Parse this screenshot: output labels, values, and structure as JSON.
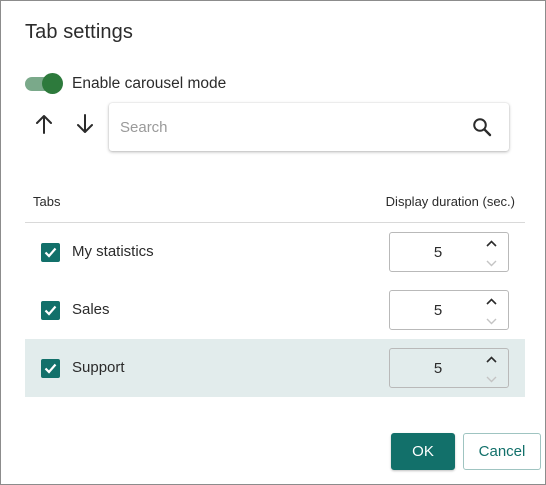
{
  "dialog": {
    "title": "Tab settings"
  },
  "carousel": {
    "label": "Enable carousel mode",
    "enabled": true
  },
  "toolbar": {
    "move_up_icon": "arrow-up-icon",
    "move_down_icon": "arrow-down-icon"
  },
  "search": {
    "placeholder": "Search",
    "value": "",
    "icon": "search-icon"
  },
  "table": {
    "headers": {
      "tabs": "Tabs",
      "duration": "Display duration (sec.)"
    },
    "rows": [
      {
        "label": "My statistics",
        "checked": true,
        "duration": "5",
        "selected": false
      },
      {
        "label": "Sales",
        "checked": true,
        "duration": "5",
        "selected": false
      },
      {
        "label": "Support",
        "checked": true,
        "duration": "5",
        "selected": true
      }
    ]
  },
  "footer": {
    "ok_label": "OK",
    "cancel_label": "Cancel"
  },
  "colors": {
    "accent": "#12706a",
    "toggle_on": "#2d7a3c",
    "selected_row": "#e2ecec"
  }
}
